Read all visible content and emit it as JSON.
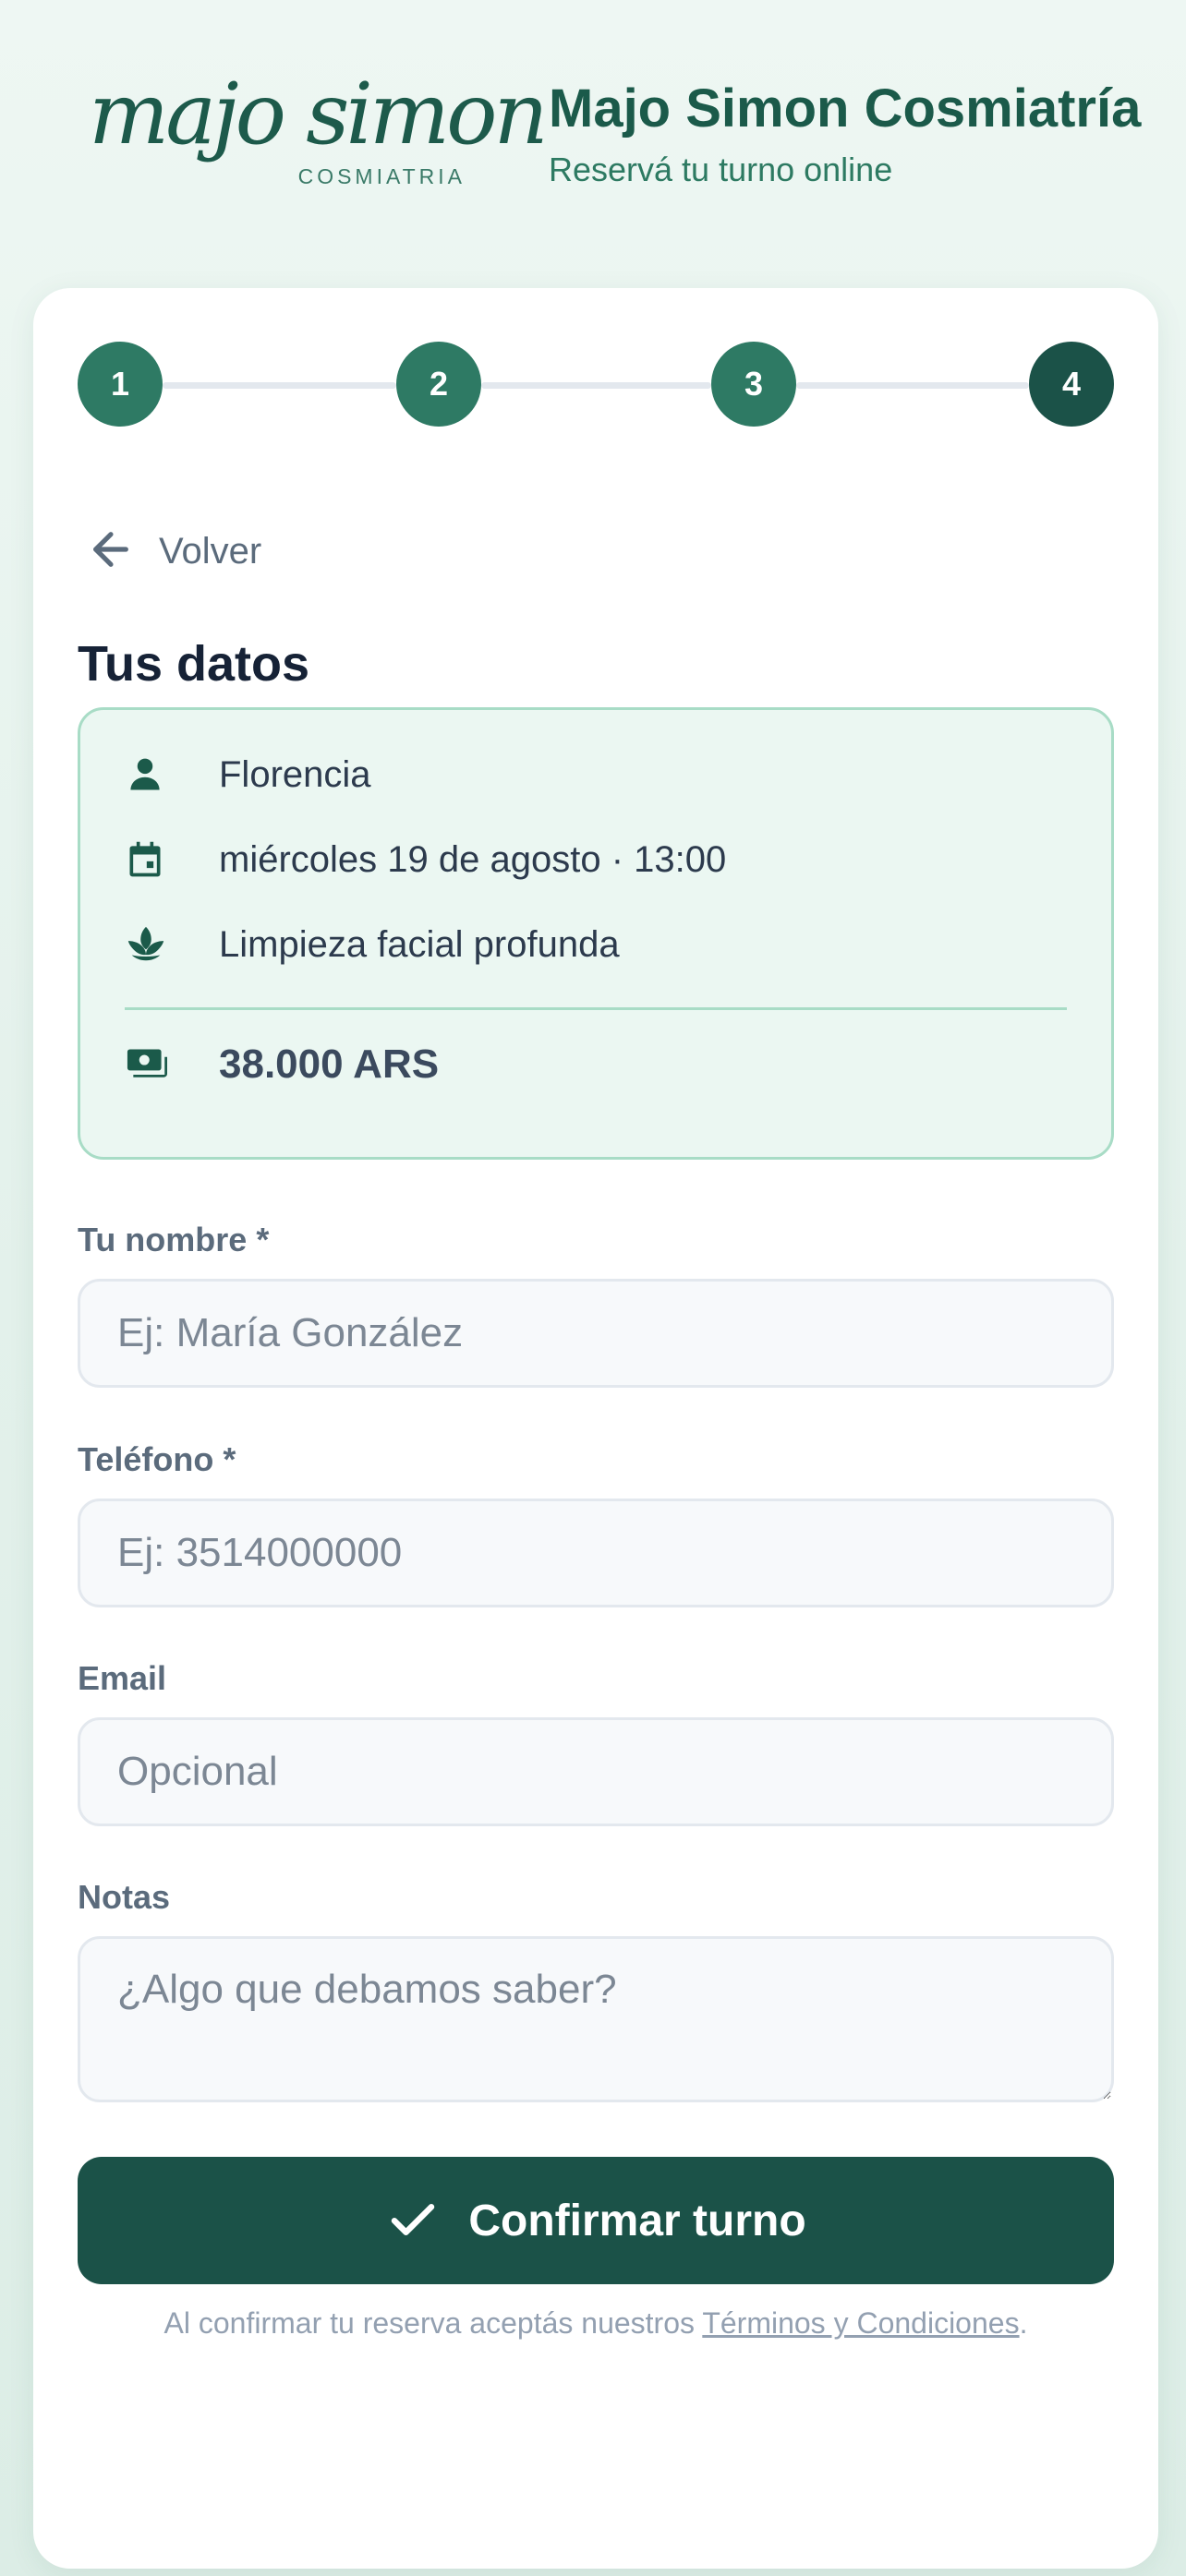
{
  "header": {
    "logo_text": "majo simon",
    "logo_subtitle": "COSMIATRIA",
    "title": "Majo Simon Cosmiatría",
    "subtitle": "Reservá tu turno online"
  },
  "stepper": {
    "steps": [
      "1",
      "2",
      "3",
      "4"
    ],
    "current_step": 4
  },
  "back": {
    "label": "Volver",
    "icon": "arrow-left-icon"
  },
  "section_title": "Tus datos",
  "summary": {
    "professional": "Florencia",
    "datetime": "miércoles 19 de agosto · 13:00",
    "service": "Limpieza facial profunda",
    "price": "38.000 ARS",
    "icons": [
      "person-icon",
      "calendar-icon",
      "lotus-icon",
      "cash-icon"
    ]
  },
  "form": {
    "name_label": "Tu nombre *",
    "name_placeholder": "Ej: María González",
    "name_value": "",
    "phone_label": "Teléfono *",
    "phone_placeholder": "Ej: 3514000000",
    "phone_value": "",
    "email_label": "Email",
    "email_placeholder": "Opcional",
    "email_value": "",
    "notes_label": "Notas",
    "notes_placeholder": "¿Algo que debamos saber?",
    "notes_value": ""
  },
  "confirm": {
    "label": "Confirmar turno",
    "icon": "check-icon"
  },
  "terms": {
    "prefix": "Al confirmar tu reserva aceptás nuestros ",
    "link": "Términos y Condiciones",
    "suffix": "."
  },
  "colors": {
    "primary": "#1b5248",
    "step": "#2e7a64",
    "brand_text": "#1b5a4a",
    "summary_bg": "#ebf7f2",
    "summary_border": "#a8dcc6"
  }
}
